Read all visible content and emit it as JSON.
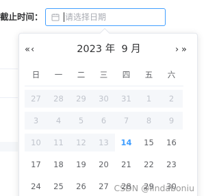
{
  "form": {
    "label": "截止时间：",
    "input_placeholder": "请选择日期",
    "input_value": ""
  },
  "picker": {
    "prev_year": "«",
    "prev_month": "‹",
    "next_month": "›",
    "next_year": "»",
    "year_label": "2023 年",
    "month_label": "9 月",
    "weekdays": [
      "日",
      "一",
      "二",
      "三",
      "四",
      "五",
      "六"
    ],
    "weeks": [
      [
        {
          "day": "27",
          "state": "disabled"
        },
        {
          "day": "28",
          "state": "disabled"
        },
        {
          "day": "29",
          "state": "disabled"
        },
        {
          "day": "30",
          "state": "disabled"
        },
        {
          "day": "31",
          "state": "disabled"
        },
        {
          "day": "1",
          "state": "disabled"
        },
        {
          "day": "2",
          "state": "disabled"
        }
      ],
      [
        {
          "day": "3",
          "state": "disabled"
        },
        {
          "day": "4",
          "state": "disabled"
        },
        {
          "day": "5",
          "state": "disabled"
        },
        {
          "day": "6",
          "state": "disabled"
        },
        {
          "day": "7",
          "state": "disabled"
        },
        {
          "day": "8",
          "state": "disabled"
        },
        {
          "day": "9",
          "state": "disabled"
        }
      ],
      [
        {
          "day": "10",
          "state": "disabled"
        },
        {
          "day": "11",
          "state": "disabled"
        },
        {
          "day": "12",
          "state": "disabled"
        },
        {
          "day": "13",
          "state": "disabled"
        },
        {
          "day": "14",
          "state": "today"
        },
        {
          "day": "15",
          "state": "normal"
        },
        {
          "day": "16",
          "state": "normal"
        }
      ],
      [
        {
          "day": "17",
          "state": "normal"
        },
        {
          "day": "18",
          "state": "normal"
        },
        {
          "day": "19",
          "state": "normal"
        },
        {
          "day": "20",
          "state": "normal"
        },
        {
          "day": "21",
          "state": "normal"
        },
        {
          "day": "22",
          "state": "normal"
        },
        {
          "day": "23",
          "state": "normal"
        }
      ],
      [
        {
          "day": "24",
          "state": "normal"
        },
        {
          "day": "25",
          "state": "normal"
        },
        {
          "day": "26",
          "state": "normal"
        },
        {
          "day": "27",
          "state": "normal"
        },
        {
          "day": "28",
          "state": "normal"
        },
        {
          "day": "29",
          "state": "normal"
        },
        {
          "day": "30",
          "state": "normal"
        }
      ]
    ]
  },
  "watermark": "CSDN @lindaboniu",
  "icons": {
    "input_icon": "calendar-icon"
  },
  "colors": {
    "accent": "#409eff",
    "disabled_bg": "#f5f7fa",
    "border": "#e4e7ed",
    "text_primary": "#303133",
    "text_regular": "#606266",
    "text_muted": "#c0c4cc"
  }
}
